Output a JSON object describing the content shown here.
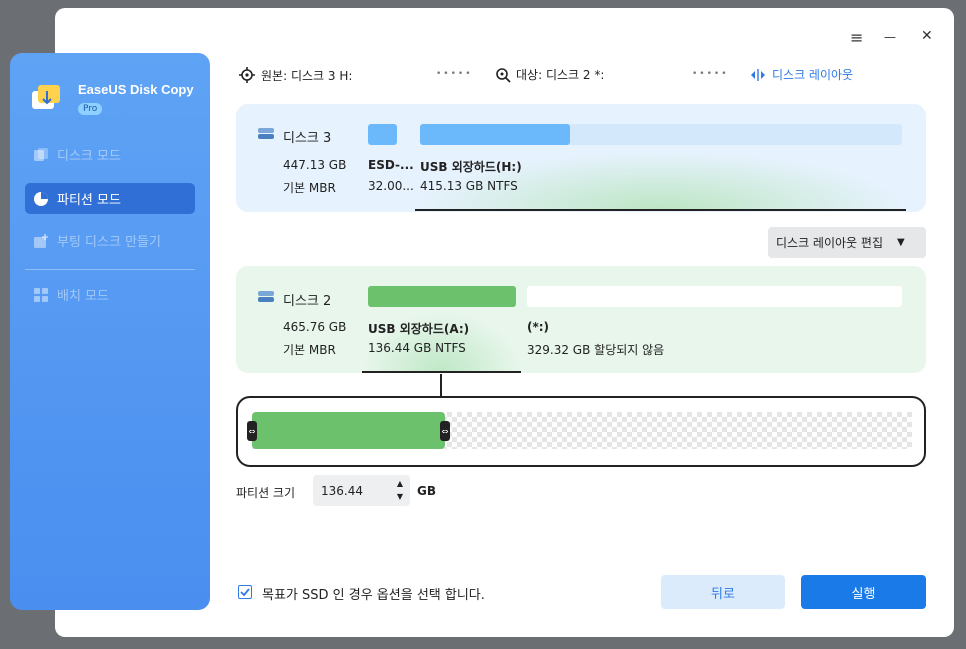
{
  "window_controls": {
    "menu": "≡",
    "minimize": "—",
    "close": "✕"
  },
  "app": {
    "name": "EaseUS Disk Copy",
    "badge": "Pro"
  },
  "sidebar": {
    "items": [
      {
        "label": "디스크 모드",
        "icon": "disk-mode-icon",
        "active": false
      },
      {
        "label": "파티션 모드",
        "icon": "partition-mode-icon",
        "active": true
      },
      {
        "label": "부팅 디스크 만들기",
        "icon": "boot-disk-icon",
        "active": false
      },
      {
        "label": "배치 모드",
        "icon": "batch-mode-icon",
        "active": false
      }
    ]
  },
  "topbar": {
    "source": "원본: 디스크 3 H:",
    "target": "대상: 디스크 2 *:",
    "layout": "디스크 레이아웃",
    "dots": "•••••"
  },
  "source_disk": {
    "name": "디스크 3",
    "size": "447.13 GB",
    "type": "기본 MBR",
    "partitions": [
      {
        "label": "ESD-...",
        "size": "32.00..."
      },
      {
        "label": "USB 외장하드(H:)",
        "size": "415.13 GB NTFS"
      }
    ]
  },
  "edit_layout": {
    "label": "디스크 레이아웃 편집"
  },
  "target_disk": {
    "name": "디스크 2",
    "size": "465.76 GB",
    "type": "기본 MBR",
    "partitions": [
      {
        "label": "USB 외장하드(A:)",
        "size": "136.44 GB NTFS"
      },
      {
        "label": "(*:)",
        "size": "329.32 GB 할당되지 않음"
      }
    ]
  },
  "resize": {
    "fill_fraction": 0.293
  },
  "partition_size": {
    "label": "파티션 크기",
    "value": "136.44",
    "unit": "GB"
  },
  "ssd_option": {
    "label": "목표가 SSD 인 경우 옵션을 선택 합니다.",
    "checked": true
  },
  "buttons": {
    "back": "뒤로",
    "run": "실행"
  },
  "colors": {
    "accent": "#1a7ae8",
    "source_bar": "#6bb8fa",
    "target_bar": "#6cc16d"
  }
}
